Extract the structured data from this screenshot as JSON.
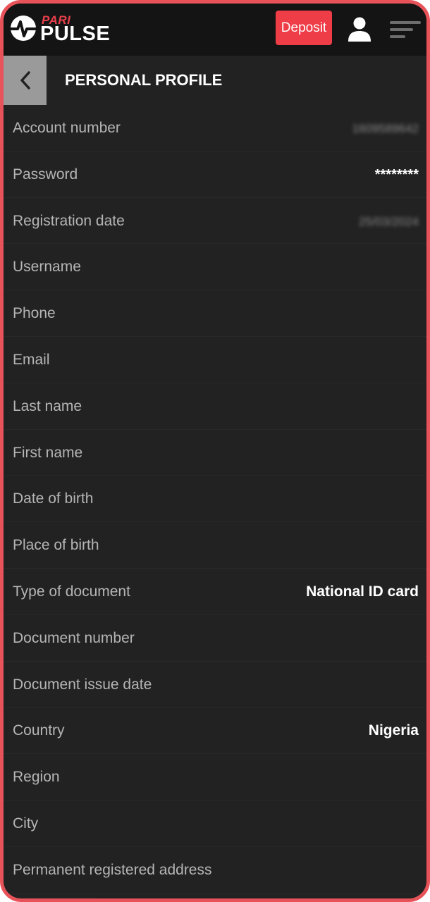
{
  "header": {
    "logo_top": "PARI",
    "logo_bottom": "PULSE",
    "deposit_label": "Deposit"
  },
  "titlebar": {
    "title": "PERSONAL PROFILE"
  },
  "rows": [
    {
      "label": "Account number",
      "value": "1609589642"
    },
    {
      "label": "Password",
      "value": "********"
    },
    {
      "label": "Registration date",
      "value": "25/03/2024"
    },
    {
      "label": "Username",
      "value": ""
    },
    {
      "label": "Phone",
      "value": ""
    },
    {
      "label": "Email",
      "value": ""
    },
    {
      "label": "Last name",
      "value": ""
    },
    {
      "label": "First name",
      "value": ""
    },
    {
      "label": "Date of birth",
      "value": ""
    },
    {
      "label": "Place of birth",
      "value": ""
    },
    {
      "label": "Type of document",
      "value": "National ID card"
    },
    {
      "label": "Document number",
      "value": ""
    },
    {
      "label": "Document issue date",
      "value": ""
    },
    {
      "label": "Country",
      "value": "Nigeria"
    },
    {
      "label": "Region",
      "value": ""
    },
    {
      "label": "City",
      "value": ""
    },
    {
      "label": "Permanent registered address",
      "value": ""
    }
  ],
  "colors": {
    "accent": "#ef3d48",
    "background": "#222222",
    "header": "#141414",
    "frame": "#e8535a"
  }
}
